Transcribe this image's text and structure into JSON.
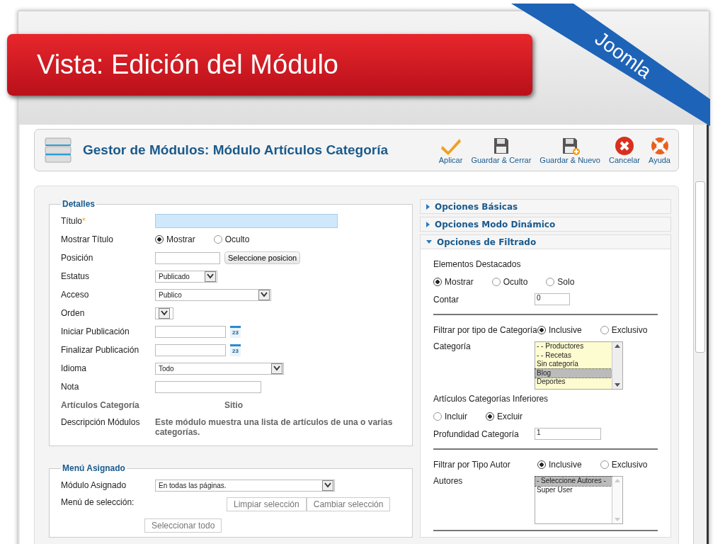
{
  "slide": {
    "title": "Vista: Edición del Módulo",
    "ribbon": "Joomla"
  },
  "header": {
    "title": "Gestor de Módulos: Módulo Artículos Categoría"
  },
  "toolbar": [
    {
      "kind": "apply",
      "label": "Aplicar"
    },
    {
      "kind": "save-close",
      "label": "Guardar & Cerrar"
    },
    {
      "kind": "save-new",
      "label": "Guardar & Nuevo"
    },
    {
      "kind": "cancel",
      "label": "Cancelar"
    },
    {
      "kind": "help",
      "label": "Ayuda"
    }
  ],
  "details": {
    "legend": "Detalles",
    "rows": [
      {
        "kind": "text",
        "label": "Título",
        "required_mark": "*",
        "focused": true
      },
      {
        "kind": "radio",
        "label": "Mostrar Título",
        "options": [
          {
            "label": "Mostrar",
            "selected": true
          },
          {
            "label": "Oculto",
            "selected": false
          }
        ]
      },
      {
        "kind": "text-button",
        "label": "Posición",
        "button": "Seleccione posicion"
      },
      {
        "kind": "select",
        "label": "Estatus",
        "value": "Publicado"
      },
      {
        "kind": "select",
        "label": "Acceso",
        "value": "Publico"
      },
      {
        "kind": "select",
        "label": "Orden"
      },
      {
        "kind": "date",
        "label": "Iniciar Publicación",
        "calendar_day": "23"
      },
      {
        "kind": "date",
        "label": "Finalizar Publicación",
        "calendar_day": "23"
      },
      {
        "kind": "select",
        "label": "Idioma",
        "value": "Todo"
      },
      {
        "kind": "text",
        "label": "Nota",
        "focused": false
      },
      {
        "kind": "info",
        "label": "Artículos Categoría",
        "value": "Sitio"
      },
      {
        "kind": "description",
        "label": "Descripción Módulos",
        "value": "Este módulo muestra una lista de artículos de una o varias categorías."
      }
    ]
  },
  "menu_assignment": {
    "legend": "Menú Asignado",
    "rows": [
      {
        "kind": "select",
        "label": "Módulo Asignado",
        "value": "En todas las páginas."
      },
      {
        "kind": "buttons",
        "label": "Menú de selección:",
        "buttons": [
          "Limpiar selección",
          "Cambiar selección"
        ]
      }
    ],
    "extra_button": "Seleccionar todo"
  },
  "options": [
    {
      "title": "Opciones Básicas",
      "expanded": false
    },
    {
      "title": "Opciones Modo Dinámico",
      "expanded": false
    },
    {
      "title": "Opciones de Filtrado",
      "expanded": true,
      "rows": [
        {
          "kind": "heading",
          "label": "Elementos Destacados"
        },
        {
          "kind": "radio",
          "options": [
            {
              "label": "Mostrar",
              "selected": true
            },
            {
              "label": "Oculto",
              "selected": false
            },
            {
              "label": "Solo",
              "selected": false
            }
          ]
        },
        {
          "kind": "text",
          "label": "Contar",
          "value": "0"
        },
        {
          "kind": "divider"
        },
        {
          "kind": "radio",
          "label": "Filtrar por tipo de Categoría",
          "options": [
            {
              "label": "Inclusive",
              "selected": true
            },
            {
              "label": "Exclusivo",
              "selected": false
            }
          ]
        },
        {
          "kind": "listbox",
          "label": "Categoría",
          "tinted": true,
          "items": [
            {
              "label": "- - Productores",
              "selected": false
            },
            {
              "label": "- - Recetas",
              "selected": false
            },
            {
              "label": "Sin categoría",
              "selected": false
            },
            {
              "label": "Blog",
              "selected": true
            },
            {
              "label": "Deportes",
              "selected": false
            }
          ]
        },
        {
          "kind": "heading",
          "label": "Artículos Categorías Inferiores"
        },
        {
          "kind": "radio",
          "options": [
            {
              "label": "Incluir",
              "selected": false
            },
            {
              "label": "Excluir",
              "selected": true
            }
          ]
        },
        {
          "kind": "text",
          "label": "Profundidad Categoría",
          "value": "1"
        },
        {
          "kind": "divider"
        },
        {
          "kind": "radio",
          "label": "Filtrar por Tipo Autor",
          "options": [
            {
              "label": "Inclusive",
              "selected": true
            },
            {
              "label": "Exclusivo",
              "selected": false
            }
          ]
        },
        {
          "kind": "listbox",
          "label": "Autores",
          "tinted": false,
          "items": [
            {
              "label": "- Seleccione Autores -",
              "selected": true
            },
            {
              "label": "Super User",
              "selected": false
            }
          ]
        },
        {
          "kind": "divider"
        }
      ]
    }
  ]
}
